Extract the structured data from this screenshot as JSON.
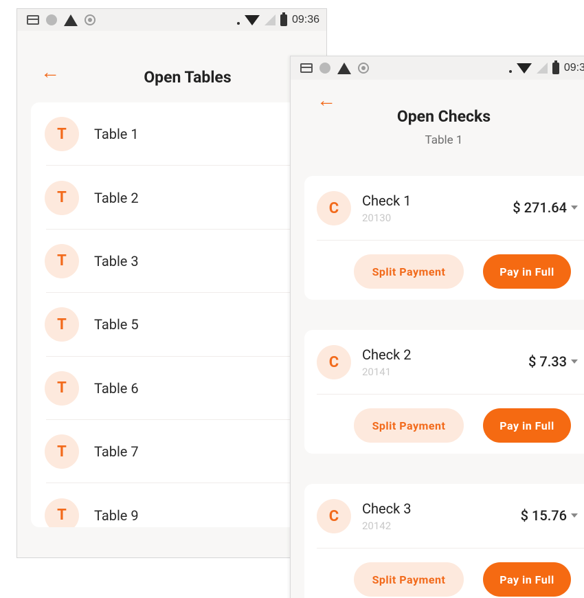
{
  "open_tables_screen": {
    "status_bar": {
      "time": "09:36"
    },
    "title": "Open Tables",
    "avatar_letter": "T",
    "tables": [
      {
        "label": "Table 1"
      },
      {
        "label": "Table 2"
      },
      {
        "label": "Table 3"
      },
      {
        "label": "Table 5"
      },
      {
        "label": "Table 6"
      },
      {
        "label": "Table 7"
      },
      {
        "label": "Table 9"
      }
    ]
  },
  "open_checks_screen": {
    "status_bar": {
      "time": "09:3"
    },
    "title": "Open Checks",
    "subtitle": "Table 1",
    "avatar_letter": "C",
    "checks": [
      {
        "name": "Check 1",
        "number": "20130",
        "amount": "$ 271.64",
        "split_label": "Split Payment",
        "pay_label": "Pay in Full"
      },
      {
        "name": "Check 2",
        "number": "20141",
        "amount": "$ 7.33",
        "split_label": "Split Payment",
        "pay_label": "Pay in Full"
      },
      {
        "name": "Check 3",
        "number": "20142",
        "amount": "$ 15.76",
        "split_label": "Split Payment",
        "pay_label": "Pay in Full"
      }
    ]
  },
  "colors": {
    "accent": "#f26a1b",
    "accent_light": "#fde9dd",
    "background": "#f8f7f6",
    "card": "#ffffff"
  },
  "icons": {
    "back": "arrow-left-icon",
    "status_left": [
      "card-icon",
      "dot-icon",
      "warning-icon",
      "sync-icon"
    ],
    "status_right": [
      "wifi-icon",
      "no-signal-icon",
      "battery-icon"
    ],
    "dropdown": "caret-down-icon"
  }
}
